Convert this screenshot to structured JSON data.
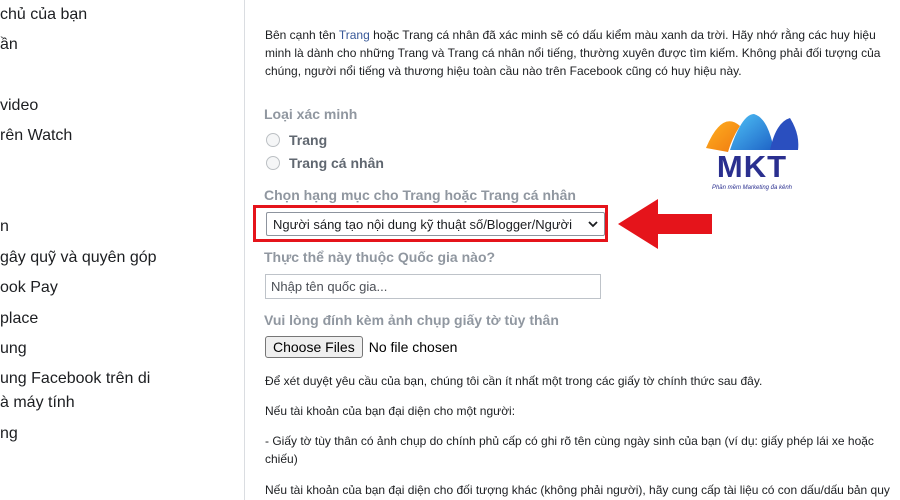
{
  "sidebar": {
    "items": [
      {
        "label": "chủ của bạn"
      },
      {
        "label": "ần"
      },
      {
        "label": " video"
      },
      {
        "label": "rên Watch"
      },
      {
        "label": "n"
      },
      {
        "label": "gây quỹ và quyên góp"
      },
      {
        "label": "ook Pay"
      },
      {
        "label": "place"
      },
      {
        "label": "ung"
      },
      {
        "label": "ung Facebook trên di"
      },
      {
        "label": "à máy tính"
      },
      {
        "label": "ng"
      }
    ]
  },
  "main": {
    "intro": {
      "before_link": "Bên cạnh tên ",
      "link": "Trang",
      "line1_rest": " hoặc Trang cá nhân đã xác minh sẽ có dấu kiểm màu xanh da trời. Hãy nhớ rằng các huy hiệu",
      "line2": "minh là dành cho những Trang và Trang cá nhân nổi tiếng, thường xuyên được tìm kiếm. Không phải đối tượng của",
      "line3": "chúng, người nổi tiếng và thương hiệu toàn cầu nào trên Facebook cũng có huy hiệu này."
    },
    "verification_type": {
      "label": "Loại xác minh",
      "options": [
        "Trang",
        "Trang cá nhân"
      ]
    },
    "category": {
      "label": "Chọn hạng mục cho Trang hoặc Trang cá nhân",
      "selected": "Người sáng tạo nội dung kỹ thuật số/Blogger/Người"
    },
    "country": {
      "label": "Thực thể này thuộc Quốc gia nào?",
      "placeholder": "Nhập tên quốc gia..."
    },
    "id_upload": {
      "label": "Vui lòng đính kèm ảnh chụp giấy tờ tùy thân",
      "button": "Choose Files",
      "status": "No file chosen"
    },
    "body_lines": [
      "Để xét duyệt yêu cầu của bạn, chúng tôi cần ít nhất một trong các giấy tờ chính thức sau đây.",
      "Nếu tài khoản của bạn đại diện cho một người:",
      "- Giấy tờ tùy thân có ảnh chụp do chính phủ cấp có ghi rõ tên cùng ngày sinh của bạn (ví dụ: giấy phép lái xe hoặc",
      "chiếu)",
      "Nếu tài khoản của bạn đại diện cho đối tượng khác (không phải người), hãy cung cấp tài liệu có con dấu/dấu bản quy"
    ]
  },
  "overlay": {
    "logo_text": "MKT",
    "logo_tagline": "Phần mềm Marketing đa kênh",
    "arrow_icon": "arrow-left-icon",
    "highlight_color": "#e5141b"
  }
}
